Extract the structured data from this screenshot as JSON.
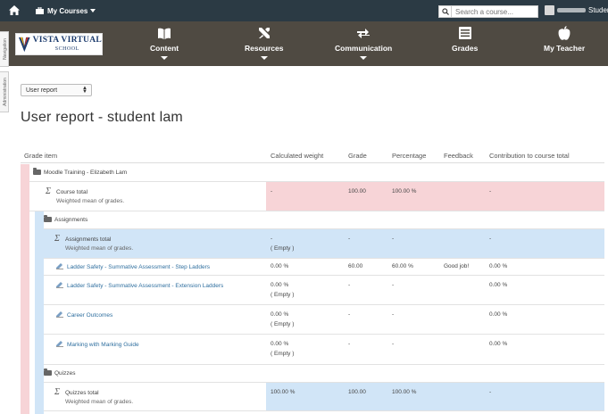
{
  "topbar": {
    "my_courses_label": "My Courses",
    "search_placeholder": "Search a course...",
    "user_name": "Student"
  },
  "brand": {
    "logo_title": "VISTA VIRTUAL",
    "logo_sub": "SCHOOL"
  },
  "nav": [
    {
      "label": "Content",
      "icon": "book-icon"
    },
    {
      "label": "Resources",
      "icon": "tools-icon"
    },
    {
      "label": "Communication",
      "icon": "exchange-icon"
    },
    {
      "label": "Grades",
      "icon": "list-icon"
    },
    {
      "label": "My Teacher",
      "icon": "apple-icon"
    }
  ],
  "sidetabs": {
    "navigation": "Navigation",
    "administration": "Administration"
  },
  "report_select": "User report",
  "page_title": "User report - student lam",
  "table": {
    "headers": {
      "item": "Grade item",
      "weight": "Calculated weight",
      "grade": "Grade",
      "percentage": "Percentage",
      "feedback": "Feedback",
      "contribution": "Contribution to course total"
    },
    "rows": {
      "category_main": "Moodle Training - Elizabeth Lam",
      "course_total": {
        "name": "Course total",
        "sub": "Weighted mean of grades.",
        "weight": "-",
        "grade": "100.00",
        "percentage": "100.00 %",
        "contribution": "-"
      },
      "category_assign": "Assignments",
      "assign_total": {
        "name": "Assignments total",
        "sub": "Weighted mean of grades.",
        "weight": "-",
        "weight2": "( Empty )",
        "grade": "-",
        "percentage": "-",
        "contribution": "-"
      },
      "items": [
        {
          "name": "Ladder Safety - Summative Assessment - Step Ladders",
          "weight": "0.00 %",
          "weight2": "",
          "grade": "60.00",
          "percentage": "60.00 %",
          "feedback": "Good job!",
          "contribution": "0.00 %"
        },
        {
          "name": "Ladder Safety - Summative Assessment - Extension Ladders",
          "weight": "0.00 %",
          "weight2": "( Empty )",
          "grade": "-",
          "percentage": "-",
          "feedback": "",
          "contribution": "0.00 %"
        },
        {
          "name": "Career Outcomes",
          "weight": "0.00 %",
          "weight2": "( Empty )",
          "grade": "-",
          "percentage": "-",
          "feedback": "",
          "contribution": "0.00 %"
        },
        {
          "name": "Marking with Marking Guide",
          "weight": "0.00 %",
          "weight2": "( Empty )",
          "grade": "-",
          "percentage": "-",
          "feedback": "",
          "contribution": "0.00 %"
        }
      ],
      "category_quiz": "Quizzes",
      "quiz_total": {
        "name": "Quizzes total",
        "sub": "Weighted mean of grades.",
        "weight": "100.00 %",
        "grade": "100.00",
        "percentage": "100.00 %",
        "contribution": "-"
      }
    }
  },
  "colors": {
    "topbar": "#2b3a44",
    "brandbar": "#4f4a42",
    "pink": "#f7d4d7",
    "blue": "#d1e5f7",
    "link": "#2f6f9f"
  }
}
